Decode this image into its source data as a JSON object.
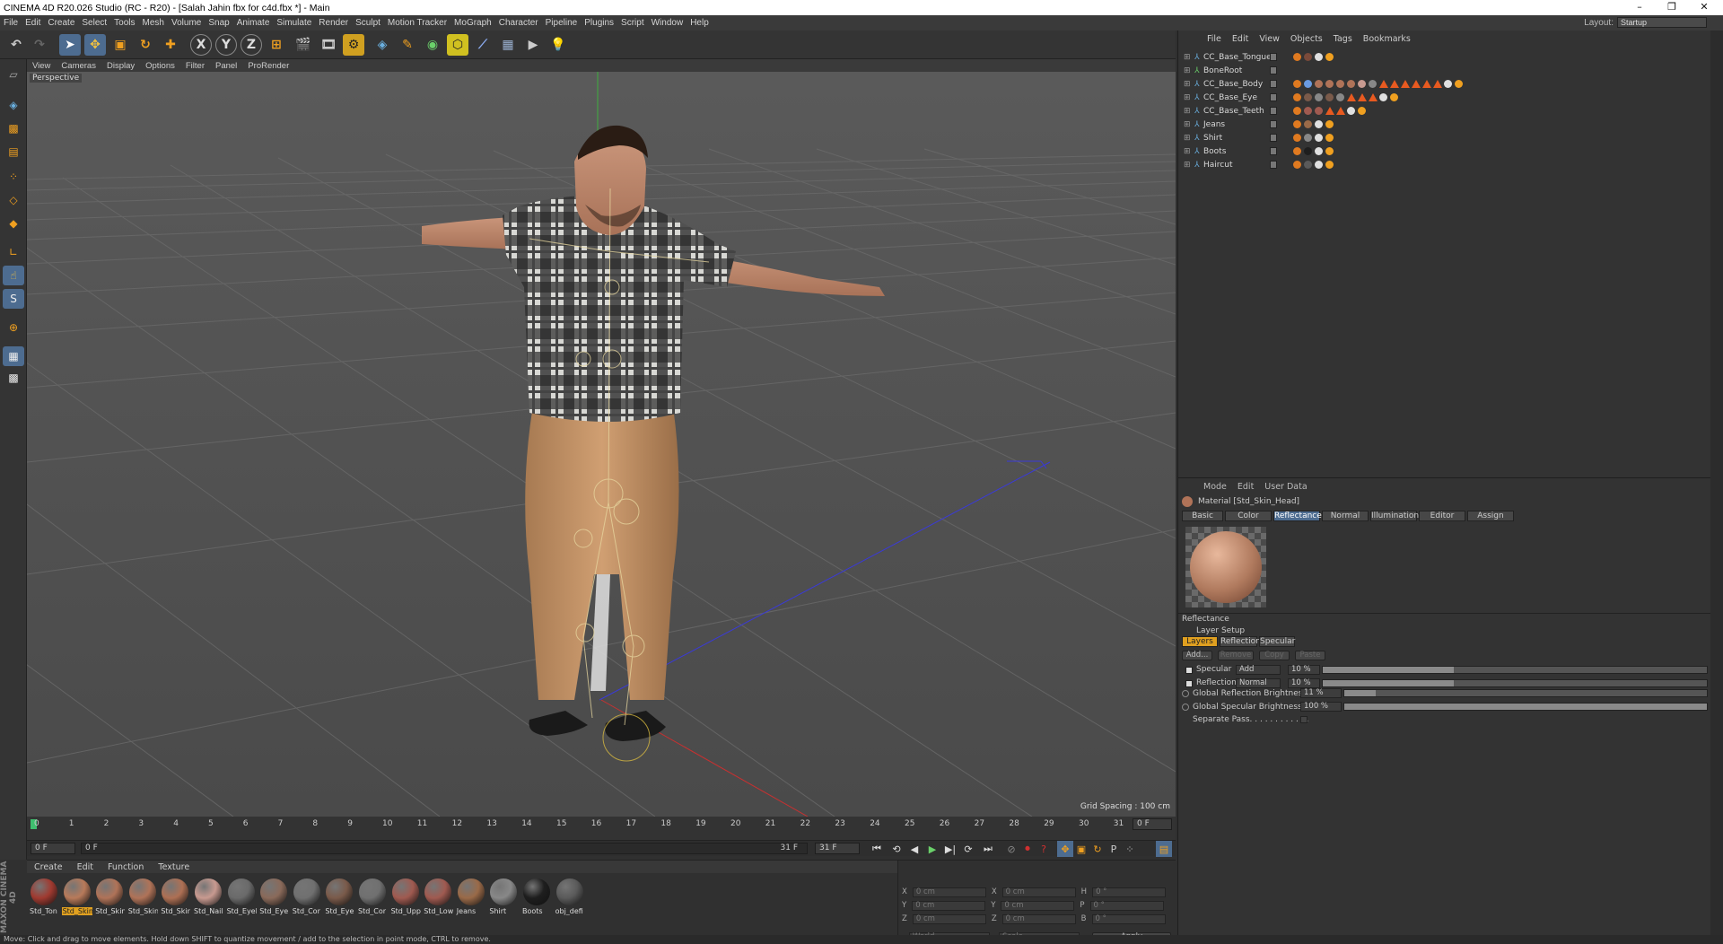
{
  "window": {
    "title": "CINEMA 4D R20.026 Studio (RC - R20) - [Salah Jahin fbx for c4d.fbx *] - Main",
    "controls": [
      "–",
      "❐",
      "✕"
    ]
  },
  "menubar": {
    "items": [
      "File",
      "Edit",
      "Create",
      "Select",
      "Tools",
      "Mesh",
      "Volume",
      "Snap",
      "Animate",
      "Simulate",
      "Render",
      "Sculpt",
      "Motion Tracker",
      "MoGraph",
      "Character",
      "Pipeline",
      "Plugins",
      "Script",
      "Window",
      "Help"
    ],
    "layout_label": "Layout:",
    "layout_value": "Startup"
  },
  "toolbar": {
    "axis_x": "X",
    "axis_y": "Y",
    "axis_z": "Z"
  },
  "viewport": {
    "menu": [
      "View",
      "Cameras",
      "Display",
      "Options",
      "Filter",
      "Panel",
      "ProRender"
    ],
    "label": "Perspective",
    "grid_spacing": "Grid Spacing : 100 cm"
  },
  "timeline": {
    "ticks": [
      "0",
      "1",
      "2",
      "3",
      "4",
      "5",
      "6",
      "7",
      "8",
      "9",
      "10",
      "11",
      "12",
      "13",
      "14",
      "15",
      "16",
      "17",
      "18",
      "19",
      "20",
      "21",
      "22",
      "23",
      "24",
      "25",
      "26",
      "27",
      "28",
      "29",
      "30",
      "31"
    ],
    "end_frame_field": "0 F",
    "current_frame": "0 F",
    "range_start": "0 F",
    "range_mid": "31 F",
    "range_end": "31 F"
  },
  "material_manager": {
    "menu": [
      "Create",
      "Edit",
      "Function",
      "Texture"
    ],
    "materials": [
      {
        "label": "Std_Ton",
        "color": "#a03a30"
      },
      {
        "label": "Std_Skin",
        "color": "#b87a5a",
        "selected": true
      },
      {
        "label": "Std_Skin",
        "color": "#b07358"
      },
      {
        "label": "Std_Skin",
        "color": "#b07358"
      },
      {
        "label": "Std_Skin",
        "color": "#ae7054"
      },
      {
        "label": "Std_Nail",
        "color": "#c89a90"
      },
      {
        "label": "Std_Eyel",
        "color": "#6a6a6a"
      },
      {
        "label": "Std_Eye",
        "color": "#8a6a5a"
      },
      {
        "label": "Std_Cor",
        "color": "#707070"
      },
      {
        "label": "Std_Eye",
        "color": "#7a5a4a"
      },
      {
        "label": "Std_Cor",
        "color": "#707070"
      },
      {
        "label": "Std_Upp",
        "color": "#a05a50"
      },
      {
        "label": "Std_Low",
        "color": "#a05a50"
      },
      {
        "label": "Jeans",
        "color": "#9a6a48"
      },
      {
        "label": "Shirt",
        "color": "#888888"
      },
      {
        "label": "Boots",
        "color": "#1e1e1e"
      },
      {
        "label": "obj_defi",
        "color": "#5a5a5a"
      }
    ]
  },
  "coordinates": {
    "rows": [
      {
        "a": "X",
        "av": "0 cm",
        "b": "X",
        "bv": "0 cm",
        "c": "H",
        "cv": "0 °"
      },
      {
        "a": "Y",
        "av": "0 cm",
        "b": "Y",
        "bv": "0 cm",
        "c": "P",
        "cv": "0 °"
      },
      {
        "a": "Z",
        "av": "0 cm",
        "b": "Z",
        "bv": "0 cm",
        "c": "B",
        "cv": "0 °"
      }
    ],
    "mode": "World",
    "scale": "Scale",
    "apply": "Apply"
  },
  "status": "Move: Click and drag to move elements. Hold down SHIFT to quantize movement / add to the selection in point mode, CTRL to remove.",
  "object_manager": {
    "menu": [
      "File",
      "Edit",
      "View",
      "Objects",
      "Tags",
      "Bookmarks"
    ],
    "objects": [
      {
        "name": "CC_Base_Tongue",
        "tags": [
          "#e07a20",
          "#7a4a3a",
          "#e0e0e0",
          "#f0a020"
        ]
      },
      {
        "name": "BoneRoot",
        "tags": []
      },
      {
        "name": "CC_Base_Body",
        "tags": [
          "#e07a20",
          "#6a9ae0",
          "#b07358",
          "#b07358",
          "#b07358",
          "#b07358",
          "#c89a90",
          "#888888",
          "#e85a20",
          "#e85a20",
          "#e85a20",
          "#e85a20",
          "#e85a20",
          "#e85a20",
          "#e0e0e0",
          "#f0a020"
        ]
      },
      {
        "name": "CC_Base_Eye",
        "tags": [
          "#e07a20",
          "#7a5a4a",
          "#888888",
          "#7a5a4a",
          "#888888",
          "#e85a20",
          "#e85a20",
          "#e85a20",
          "#e0e0e0",
          "#f0a020"
        ]
      },
      {
        "name": "CC_Base_Teeth",
        "tags": [
          "#e07a20",
          "#a05a50",
          "#a05a50",
          "#e85a20",
          "#e85a20",
          "#e0e0e0",
          "#f0a020"
        ]
      },
      {
        "name": "Jeans",
        "tags": [
          "#e07a20",
          "#9a6a48",
          "#e0e0e0",
          "#f0a020"
        ]
      },
      {
        "name": "Shirt",
        "tags": [
          "#e07a20",
          "#888888",
          "#e0e0e0",
          "#f0a020"
        ]
      },
      {
        "name": "Boots",
        "tags": [
          "#e07a20",
          "#1e1e1e",
          "#e0e0e0",
          "#f0a020"
        ]
      },
      {
        "name": "Haircut",
        "tags": [
          "#e07a20",
          "#5a5a5a",
          "#e0e0e0",
          "#f0a020"
        ]
      }
    ]
  },
  "attribute_manager": {
    "menu": [
      "Mode",
      "Edit",
      "User Data"
    ],
    "material_title": "Material [Std_Skin_Head]",
    "tabs": [
      "Basic",
      "Color",
      "Reflectance",
      "Normal",
      "Illumination",
      "Editor",
      "Assign"
    ],
    "active_tab": "Reflectance",
    "section": "Reflectance",
    "layer_setup": "Layer Setup",
    "layer_tabs": [
      "Layers",
      "Reflection",
      "Specular"
    ],
    "buttons": [
      "Add...",
      "Remove",
      "Copy",
      "Paste"
    ],
    "layers": [
      {
        "name": "Specular",
        "mode": "Add",
        "value": "10 %",
        "fraction": 0.1
      },
      {
        "name": "Reflection",
        "mode": "Normal",
        "value": "10 %",
        "fraction": 0.1
      }
    ],
    "global_reflection_label": "Global Reflection Brightness",
    "global_reflection_value": "11 %",
    "global_reflection_fraction": 0.11,
    "global_specular_label": "Global Specular Brightness",
    "global_specular_value": "100 %",
    "global_specular_fraction": 1.0,
    "separate_pass": "Separate Pass. . . . . . . . . . . ."
  },
  "colors": {
    "accent_orange": "#e0a020",
    "selection_blue": "#4d6c90",
    "viewport_bg": "#4e4e4e"
  }
}
